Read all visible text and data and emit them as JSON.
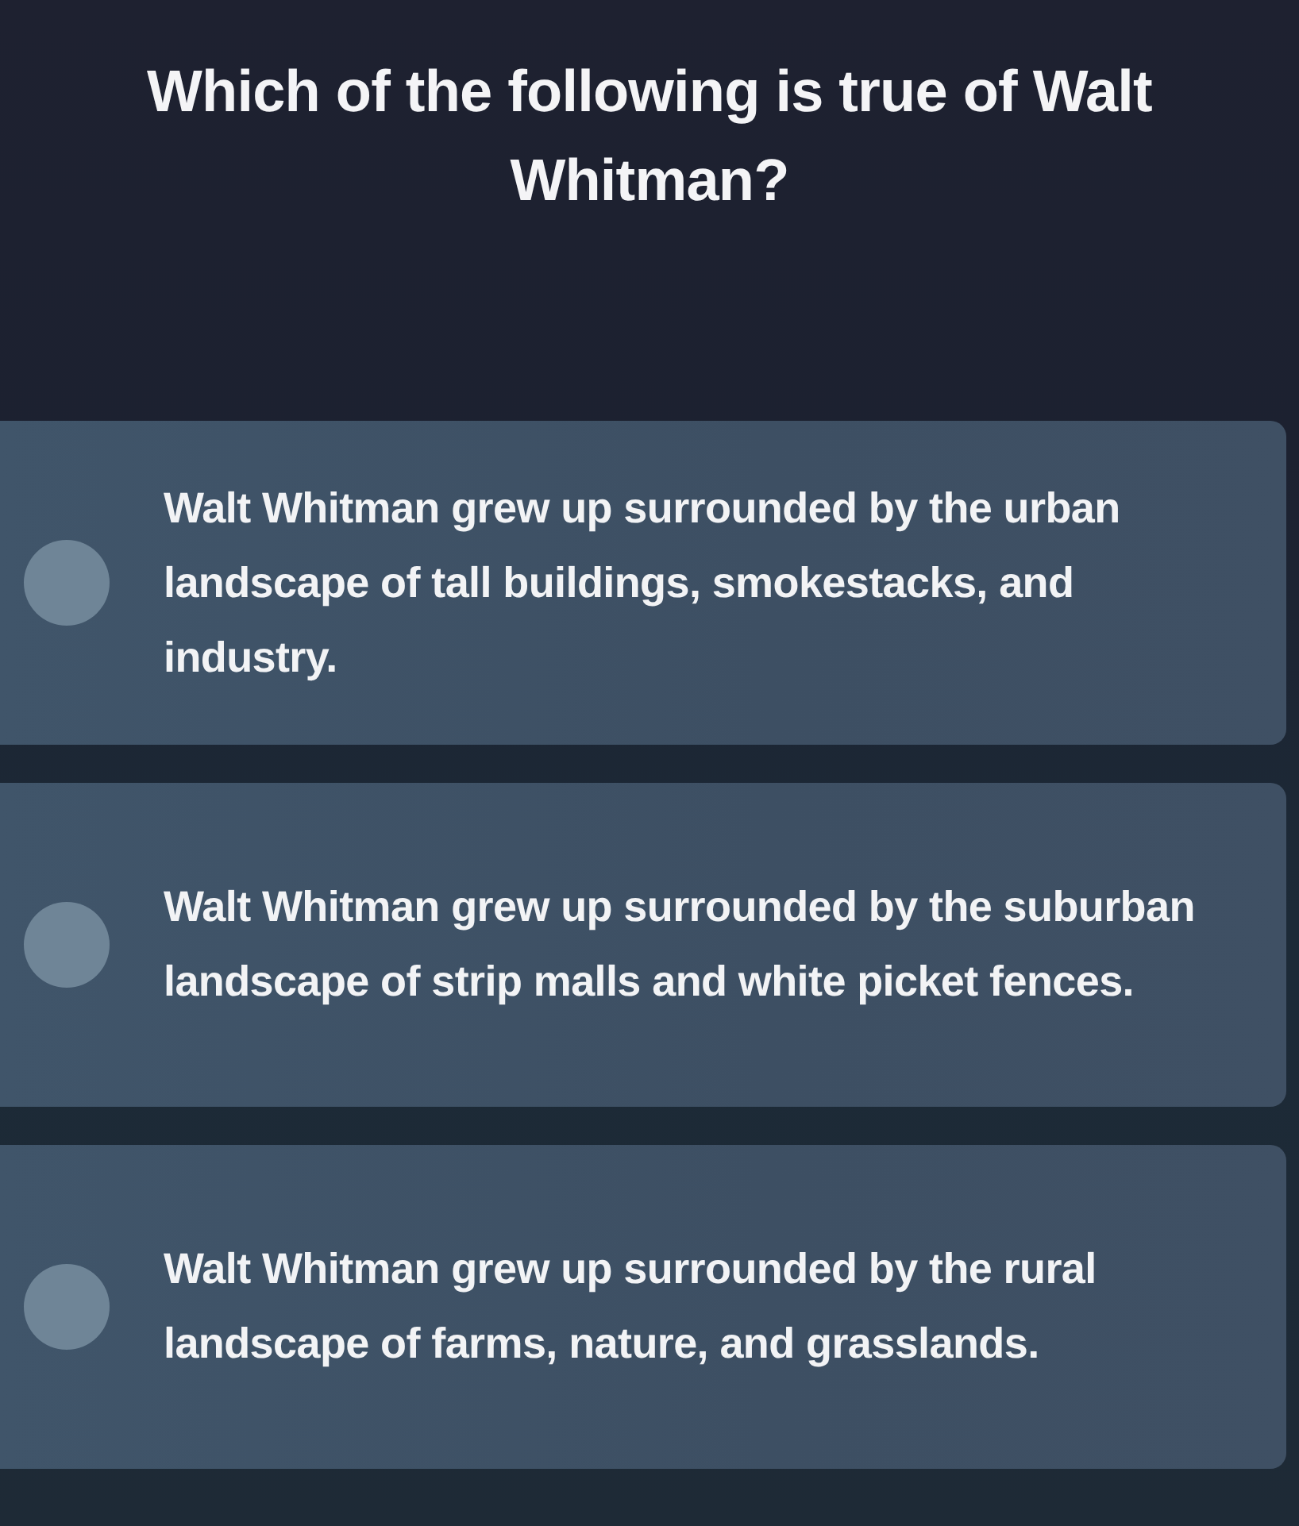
{
  "question": "Which of the following is true of Walt Whitman?",
  "options": [
    {
      "text": "Walt Whitman grew up surrounded by the urban landscape of tall buildings, smokestacks, and industry.",
      "selected": false
    },
    {
      "text": "Walt Whitman grew up surrounded by the suburban landscape of strip malls and white picket fences.",
      "selected": false
    },
    {
      "text": "Walt Whitman grew up surrounded by the rural landscape of farms, nature, and grasslands.",
      "selected": false
    }
  ]
}
